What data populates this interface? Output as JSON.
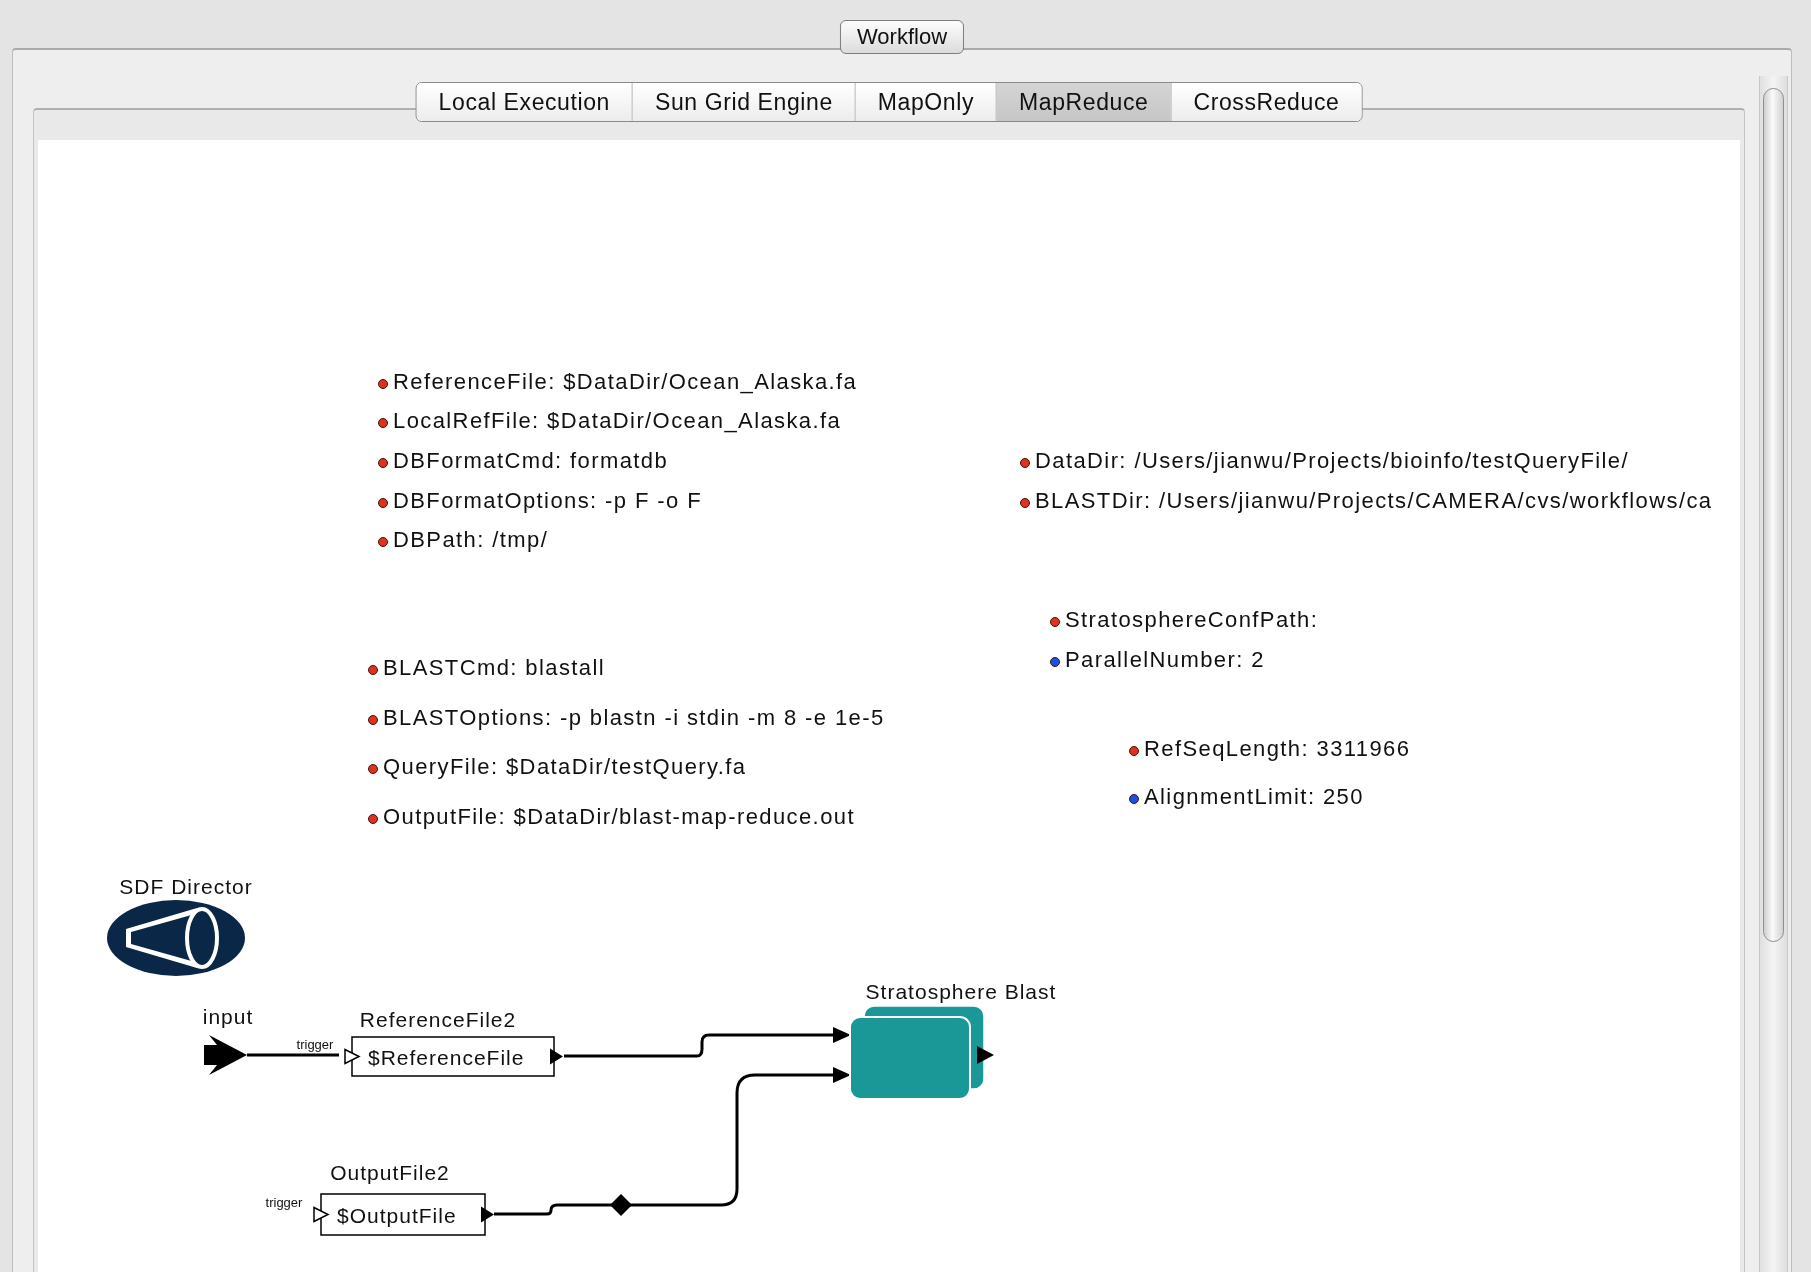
{
  "title_button": "Workflow",
  "tabs": [
    {
      "label": "Local Execution",
      "selected": false
    },
    {
      "label": "Sun Grid Engine",
      "selected": false
    },
    {
      "label": "MapOnly",
      "selected": false
    },
    {
      "label": "MapReduce",
      "selected": true
    },
    {
      "label": "CrossReduce",
      "selected": false
    }
  ],
  "parameters": [
    {
      "text": "ReferenceFile: $DataDir/Ocean_Alaska.fa",
      "color": "#e0301e"
    },
    {
      "text": "LocalRefFile: $DataDir/Ocean_Alaska.fa",
      "color": "#e0301e"
    },
    {
      "text": "DBFormatCmd: formatdb",
      "color": "#e0301e"
    },
    {
      "text": "DBFormatOptions:  -p F -o F",
      "color": "#e0301e"
    },
    {
      "text": "DBPath: /tmp/",
      "color": "#e0301e"
    },
    {
      "text": "DataDir: /Users/jianwu/Projects/bioinfo/testQueryFile/",
      "color": "#e0301e"
    },
    {
      "text": "BLASTDir: /Users/jianwu/Projects/CAMERA/cvs/workflows/ca",
      "color": "#e0301e"
    },
    {
      "text": "StratosphereConfPath:",
      "color": "#e0301e"
    },
    {
      "text": "ParallelNumber: 2",
      "color": "#1d4fe0"
    },
    {
      "text": "BLASTCmd: blastall",
      "color": "#e0301e"
    },
    {
      "text": "BLASTOptions:  -p blastn -i stdin -m 8 -e 1e-5",
      "color": "#e0301e"
    },
    {
      "text": "QueryFile: $DataDir/testQuery.fa",
      "color": "#e0301e"
    },
    {
      "text": "OutputFile: $DataDir/blast-map-reduce.out",
      "color": "#e0301e"
    },
    {
      "text": "RefSeqLength: 3311966",
      "color": "#e0301e"
    },
    {
      "text": "AlignmentLimit: 250",
      "color": "#1d4fe0"
    }
  ],
  "director": {
    "label": "SDF Director"
  },
  "actors": [
    {
      "kind": "port",
      "label": "input"
    },
    {
      "kind": "constant",
      "label": "ReferenceFile2",
      "value": "$ReferenceFile",
      "trigger": "trigger"
    },
    {
      "kind": "constant",
      "label": "OutputFile2",
      "value": "$OutputFile",
      "trigger": "trigger"
    },
    {
      "kind": "composite",
      "label": "Stratosphere Blast"
    }
  ]
}
